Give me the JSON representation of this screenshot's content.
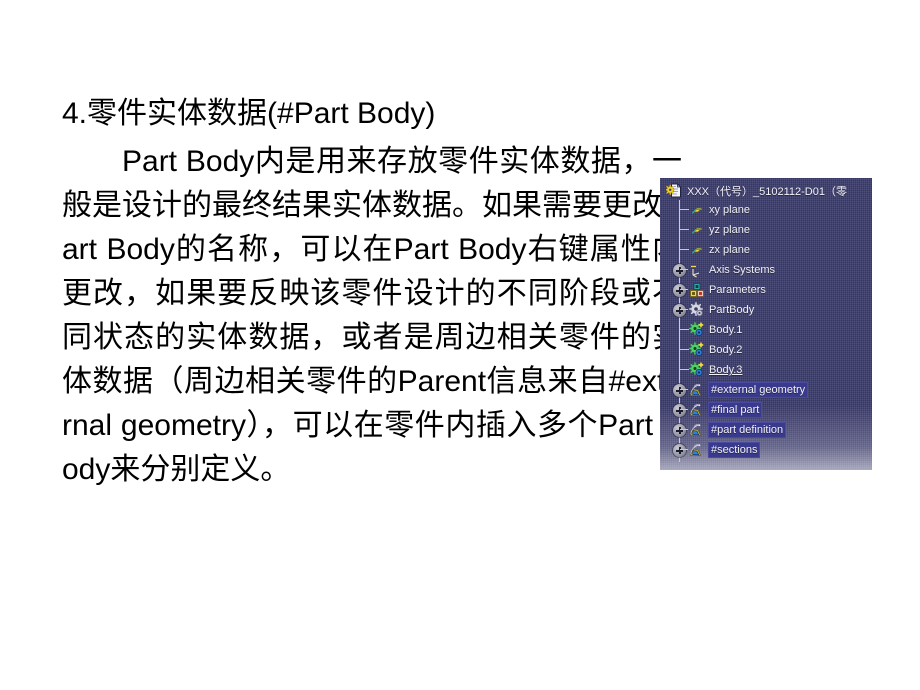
{
  "slide": {
    "heading": "4.零件实体数据(#Part Body)",
    "body_paragraph": "Part Body内是用来存放零件实体数据，一般是设计的最终结果实体数据。如果需要更改Part Body的名称，可以在Part Body右键属性内更改，如果要反映该零件设计的不同阶段或不同状态的实体数据，或者是周边相关零件的实体数据（周边相关零件的Parent信息来自#external geometry），可以在零件内插入多个Part Body来分别定义。",
    "body_lines": [
      "Part Body内是用来存放零件实",
      "体数据，一般是设计的最终结果实",
      "体数据。如果需要更改Part Body的",
      "名称，可以在Part Body右键属性内",
      "更改，如果要反映该零件设计的不",
      "同阶段或不同状态的实体数据，或",
      "者是周边相关零件的实体数据（周",
      "边相关零件的Parent信息来自",
      "#external geometry），可以在零",
      "件内插入多个Part Body来分别定义。"
    ]
  },
  "tree": {
    "root": {
      "label": "XXX（代号）_5102112-D01（零",
      "icon": "part-document-icon"
    },
    "nodes": [
      {
        "label": "xy plane",
        "icon": "plane-icon",
        "expandable": false,
        "selected": false,
        "inwork": false
      },
      {
        "label": "yz plane",
        "icon": "plane-icon",
        "expandable": false,
        "selected": false,
        "inwork": false
      },
      {
        "label": "zx plane",
        "icon": "plane-icon",
        "expandable": false,
        "selected": false,
        "inwork": false
      },
      {
        "label": "Axis Systems",
        "icon": "axis-system-icon",
        "expandable": true,
        "selected": false,
        "inwork": false
      },
      {
        "label": "Parameters",
        "icon": "parameters-icon",
        "expandable": true,
        "selected": false,
        "inwork": false
      },
      {
        "label": "PartBody",
        "icon": "partbody-icon",
        "expandable": true,
        "selected": false,
        "inwork": false
      },
      {
        "label": "Body.1",
        "icon": "body-icon",
        "expandable": false,
        "selected": false,
        "inwork": false
      },
      {
        "label": "Body.2",
        "icon": "body-icon",
        "expandable": false,
        "selected": false,
        "inwork": false
      },
      {
        "label": "Body.3",
        "icon": "body-icon",
        "expandable": false,
        "selected": false,
        "inwork": true
      },
      {
        "label": "#external geometry",
        "icon": "geometrical-set-icon",
        "expandable": true,
        "selected": true,
        "inwork": false
      },
      {
        "label": "#final part",
        "icon": "geometrical-set-icon",
        "expandable": true,
        "selected": true,
        "inwork": false
      },
      {
        "label": "#part definition",
        "icon": "geometrical-set-icon",
        "expandable": true,
        "selected": true,
        "inwork": false
      },
      {
        "label": "#sections",
        "icon": "geometrical-set-icon",
        "expandable": true,
        "selected": true,
        "inwork": false
      }
    ]
  },
  "colors": {
    "slide_background": "#ffffff",
    "slide_text": "#000000",
    "tree_background": "#3c3c6e",
    "tree_text": "#f0f0f6",
    "tree_selection": "#3a3a8c",
    "tree_line": "#c9c9dd",
    "plane_icon": "#f3d44a"
  }
}
